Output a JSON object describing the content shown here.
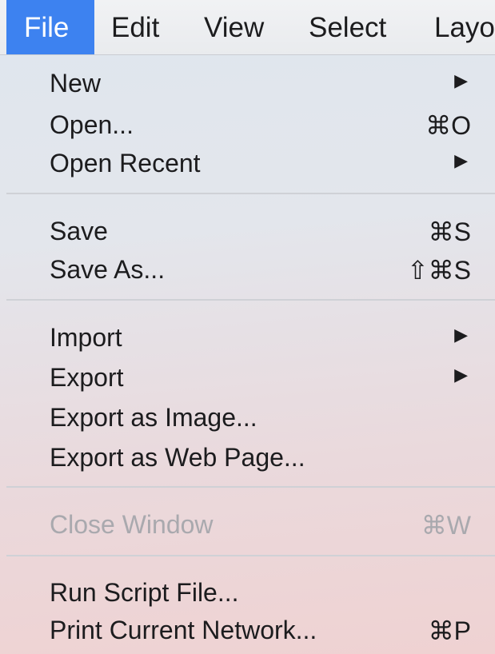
{
  "menubar": {
    "items": [
      {
        "label": "File",
        "active": true
      },
      {
        "label": "Edit"
      },
      {
        "label": "View"
      },
      {
        "label": "Select"
      },
      {
        "label": "Layout"
      }
    ]
  },
  "menu": {
    "items": [
      {
        "label": "New",
        "submenu": true
      },
      {
        "label": "Open...",
        "shortcut": "⌘O"
      },
      {
        "label": "Open Recent",
        "submenu": true
      },
      {
        "label": "Save",
        "shortcut": "⌘S"
      },
      {
        "label": "Save As...",
        "shortcut": "⇧⌘S"
      },
      {
        "label": "Import",
        "submenu": true
      },
      {
        "label": "Export",
        "submenu": true
      },
      {
        "label": "Export as Image..."
      },
      {
        "label": "Export as Web Page..."
      },
      {
        "label": "Close Window",
        "shortcut": "⌘W",
        "disabled": true
      },
      {
        "label": "Run Script File..."
      },
      {
        "label": "Print Current Network...",
        "shortcut": "⌘P"
      }
    ],
    "submenu_arrow": "▶"
  },
  "colors": {
    "accent": "#3d82f0",
    "text": "#1c1c1e",
    "disabled_text": "#a9a9ae"
  }
}
